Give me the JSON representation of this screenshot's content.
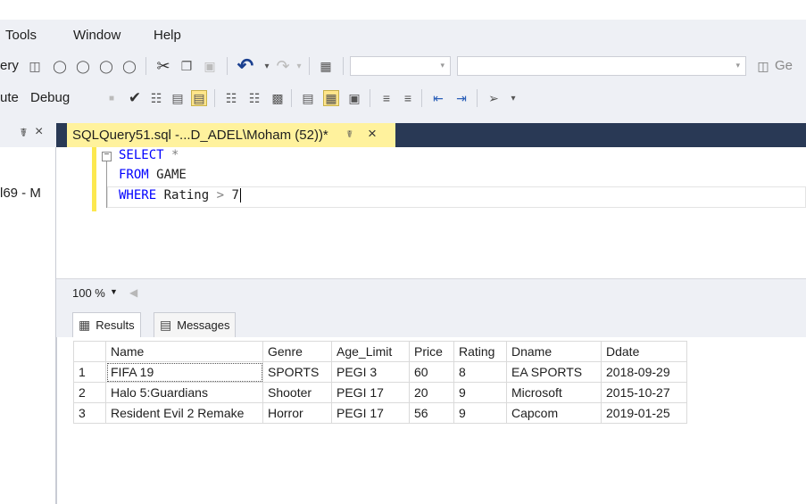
{
  "menubar": {
    "items": [
      "Tools",
      "Window",
      "Help"
    ]
  },
  "toolbar1": {
    "partial_label": "ery",
    "combo_right_label": "Ge"
  },
  "toolbar2": {
    "execute_label": "ute",
    "debug_label": "Debug"
  },
  "left_panel": {
    "text": "l69 - M"
  },
  "document_tab": {
    "title": "SQLQuery51.sql -...D_ADEL\\Moham (52))*"
  },
  "editor": {
    "lines": [
      {
        "kw": "SELECT",
        "rest": " *"
      },
      {
        "kw": "FROM",
        "rest": " GAME"
      },
      {
        "kw": "WHERE",
        "rest": " Rating ",
        "op": ">",
        "tail": " 7"
      }
    ]
  },
  "zoom": {
    "value": "100 %"
  },
  "results_tabs": {
    "results": "Results",
    "messages": "Messages"
  },
  "grid": {
    "columns": [
      "Name",
      "Genre",
      "Age_Limit",
      "Price",
      "Rating",
      "Dname",
      "Ddate"
    ],
    "rows": [
      {
        "n": "1",
        "cells": [
          "FIFA 19",
          "SPORTS",
          "PEGI 3",
          "60",
          "8",
          "EA SPORTS",
          "2018-09-29"
        ]
      },
      {
        "n": "2",
        "cells": [
          "Halo 5:Guardians",
          "Shooter",
          "PEGI 17",
          "20",
          "9",
          "Microsoft",
          "2015-10-27"
        ]
      },
      {
        "n": "3",
        "cells": [
          "Resident Evil 2 Remake",
          "Horror",
          "PEGI 17",
          "56",
          "9",
          "Capcom",
          "2019-01-25"
        ]
      }
    ]
  }
}
